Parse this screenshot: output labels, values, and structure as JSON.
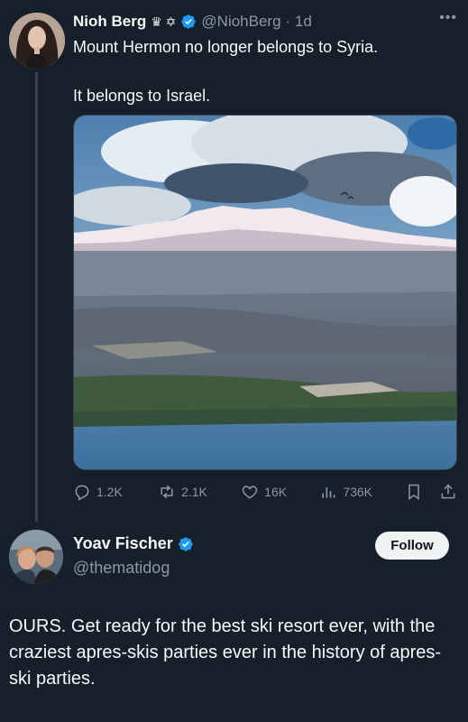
{
  "tweet": {
    "author": {
      "name": "Nioh Berg",
      "name_emojis": "♛ ✡",
      "handle": "@NiohBerg",
      "time": "· 1d",
      "verified": true
    },
    "text_line1": "Mount Hermon no longer belongs to Syria.",
    "text_line2": "It belongs to Israel.",
    "metrics": {
      "replies": "1.2K",
      "reposts": "2.1K",
      "likes": "16K",
      "views": "736K"
    }
  },
  "reply": {
    "author": {
      "name": "Yoav Fischer",
      "handle": "@thematidog",
      "verified": true
    },
    "follow_label": "Follow",
    "text": "OURS. Get ready for the best ski resort ever, with the craziest apres-skis parties ever in the history of apres-ski parties."
  },
  "colors": {
    "background": "#15202b",
    "verified_blue": "#1d9bf0",
    "muted": "#8b98a5"
  }
}
